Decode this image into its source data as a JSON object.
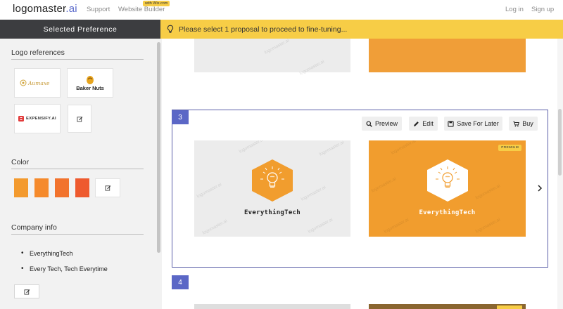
{
  "header": {
    "brand_main": "logomaster",
    "brand_suffix": ".ai",
    "nav": [
      "Support",
      "Website Builder"
    ],
    "wix_badge": "with Wix.com",
    "login": "Log in",
    "signup": "Sign up"
  },
  "preference_header": "Selected Preference",
  "banner": {
    "icon": "lightbulb-icon",
    "text": "Please select 1 proposal to proceed to fine-tuning..."
  },
  "sidebar": {
    "logo_references_title": "Logo references",
    "logo_references": [
      "Aumaxe",
      "Baker Nuts",
      "EXPENSIFY.AI"
    ],
    "color_title": "Color",
    "colors": [
      "#f39a2e",
      "#f58a2c",
      "#f2732d",
      "#ee5a2e"
    ],
    "company_info_title": "Company info",
    "company_info": [
      "EverythingTech",
      "Every Tech, Tech Everytime"
    ]
  },
  "proposals": [
    {
      "number": "3",
      "actions": [
        "Preview",
        "Edit",
        "Save For Later",
        "Buy"
      ],
      "logo_name": "EverythingTech",
      "premium_label": "PREMIUM",
      "watermark": "logomaster.ai"
    },
    {
      "number": "4"
    }
  ],
  "colors": {
    "accent": "#5b67c6",
    "banner": "#f7cd46",
    "logo_orange": "#f19d2e"
  }
}
